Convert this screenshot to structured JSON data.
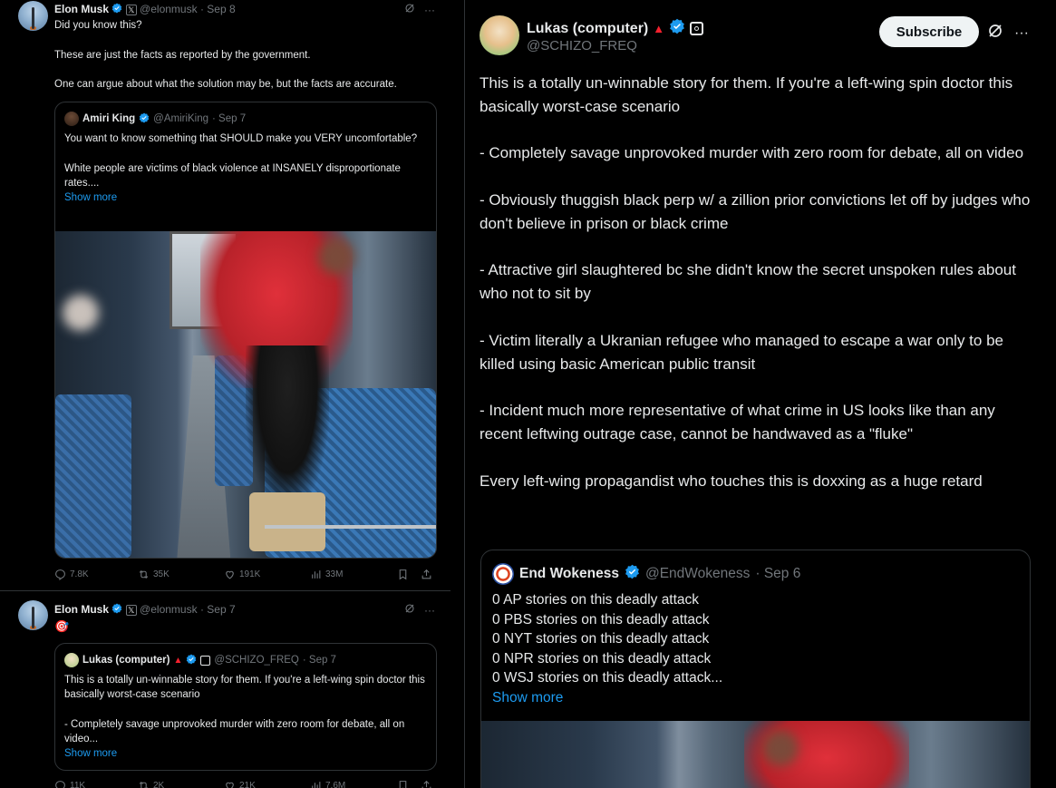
{
  "left_tweet_1": {
    "author_name": "Elon Musk",
    "handle": "@elonmusk",
    "date": "· Sep 8",
    "text": "Did you know this?\n\nThese are just the facts as reported by the government.\n\nOne can argue about what the solution may be, but the facts are accurate.",
    "quote": {
      "author_name": "Amiri King",
      "handle": "@AmiriKing",
      "date": "· Sep 7",
      "text": "You want to know something that SHOULD make you VERY uncomfortable?\n\nWhite people are victims of black violence at INSANELY disproportionate rates....",
      "show_more": "Show more"
    },
    "stats": {
      "replies": "7.8K",
      "reposts": "35K",
      "likes": "191K",
      "views": "33M"
    }
  },
  "left_tweet_2": {
    "author_name": "Elon Musk",
    "handle": "@elonmusk",
    "date": "· Sep 7",
    "text": "🎯",
    "quote": {
      "author_name": "Lukas (computer)",
      "handle": "@SCHIZO_FREQ",
      "date": "· Sep 7",
      "text": "This is a totally un-winnable story for them. If you're a left-wing spin doctor this basically worst-case scenario\n\n- Completely savage unprovoked murder with zero room for debate, all on video...",
      "show_more": "Show more"
    },
    "stats": {
      "replies": "11K",
      "reposts": "2K",
      "likes": "21K",
      "views": "7.6M"
    }
  },
  "right_post": {
    "author_name": "Lukas (computer)",
    "handle": "@SCHIZO_FREQ",
    "subscribe_label": "Subscribe",
    "body": "This is a totally un-winnable story for them. If you're a left-wing spin doctor this basically worst-case scenario\n\n- Completely savage unprovoked murder with zero room for debate, all on video\n\n- Obviously thuggish black perp w/ a zillion prior convictions let off by judges who don't believe in prison or black crime\n\n- Attractive girl slaughtered bc she didn't know the secret unspoken rules about who not to sit by\n\n- Victim literally a Ukranian refugee who managed to escape a war only to be killed using basic American public transit\n\n- Incident much more representative of what crime in US looks like than any recent leftwing outrage case, cannot be handwaved as a \"fluke\"\n\nEvery left-wing propagandist who touches this is doxxing as a huge retard",
    "quote": {
      "author_name": "End Wokeness",
      "handle": "@EndWokeness",
      "date": "· Sep 6",
      "text": "0 AP stories on this deadly attack\n0 PBS stories on this deadly attack\n0 NYT stories on this deadly attack\n0 NPR stories on this deadly attack\n0 WSJ stories on this deadly attack...",
      "show_more": "Show more"
    }
  },
  "colors": {
    "background": "#000000",
    "text": "#e7e9ea",
    "muted": "#71767b",
    "accent_blue": "#1d9bf0",
    "border": "#2f3336"
  },
  "icons": [
    "verified-badge-icon",
    "x-affiliate-icon",
    "grok-icon",
    "more-icon",
    "reply-icon",
    "repost-icon",
    "like-icon",
    "views-icon",
    "bookmark-icon",
    "share-icon",
    "triangle-badge-icon",
    "square-badge-icon"
  ]
}
